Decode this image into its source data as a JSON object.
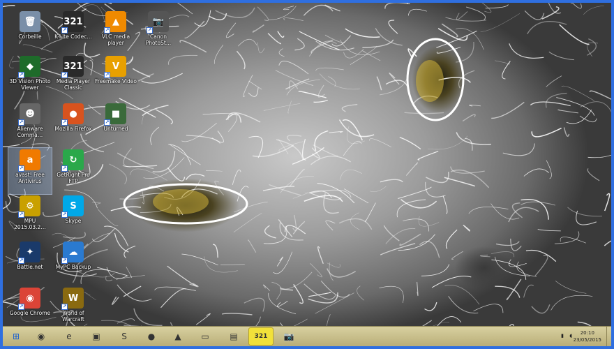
{
  "desktop": {
    "icons": [
      {
        "label": "Corbeille",
        "glyph": "🗑",
        "color": "#7a8fa8",
        "shortcut": false
      },
      {
        "label": "K-Lite Codec…",
        "glyph": "321",
        "color": "#2a2a2a",
        "shortcut": true
      },
      {
        "label": "VLC media player",
        "glyph": "▲",
        "color": "#f08a00",
        "shortcut": true
      },
      {
        "label": "Canon PhotoSt…",
        "glyph": "📷",
        "color": "#555",
        "shortcut": true
      },
      {
        "label": "3D Vision Photo Viewer",
        "glyph": "◆",
        "color": "#1e6b2a",
        "shortcut": true
      },
      {
        "label": "Media Player Classic",
        "glyph": "321",
        "color": "#2a2a2a",
        "shortcut": true
      },
      {
        "label": "Freemake Video",
        "glyph": "V",
        "color": "#e8a000",
        "shortcut": true
      },
      {
        "label": "Alienware Comma…",
        "glyph": "☻",
        "color": "#666",
        "shortcut": true
      },
      {
        "label": "Mozilla Firefox",
        "glyph": "●",
        "color": "#d9531e",
        "shortcut": true
      },
      {
        "label": "Unturned",
        "glyph": "■",
        "color": "#3a6a3a",
        "shortcut": true
      },
      {
        "label": "avast! Free Antivirus",
        "glyph": "a",
        "color": "#f07a00",
        "shortcut": true
      },
      {
        "label": "GetRight Pro FTP",
        "glyph": "↻",
        "color": "#2aa84a",
        "shortcut": true
      },
      {
        "label": "MPU 2015.03.2…",
        "glyph": "⚙",
        "color": "#c9a000",
        "shortcut": true
      },
      {
        "label": "Skype",
        "glyph": "S",
        "color": "#00a8e8",
        "shortcut": true
      },
      {
        "label": "Battle.net",
        "glyph": "✦",
        "color": "#1a3a6a",
        "shortcut": true
      },
      {
        "label": "MyPC Backup",
        "glyph": "☁",
        "color": "#2a7ad0",
        "shortcut": true
      },
      {
        "label": "Google Chrome",
        "glyph": "◉",
        "color": "#db4437",
        "shortcut": true
      },
      {
        "label": "World of Warcraft",
        "glyph": "W",
        "color": "#8a6a10",
        "shortcut": true
      }
    ]
  },
  "taskbar": {
    "items": [
      {
        "name": "start-button",
        "glyph": "⊞",
        "active": false
      },
      {
        "name": "chrome",
        "glyph": "◉",
        "active": false
      },
      {
        "name": "internet-explorer",
        "glyph": "e",
        "active": false
      },
      {
        "name": "store",
        "glyph": "▣",
        "active": false
      },
      {
        "name": "skype",
        "glyph": "S",
        "active": false
      },
      {
        "name": "firefox",
        "glyph": "●",
        "active": false
      },
      {
        "name": "vlc",
        "glyph": "▲",
        "active": false
      },
      {
        "name": "file-explorer",
        "glyph": "▭",
        "active": false
      },
      {
        "name": "app-window",
        "glyph": "▤",
        "active": false
      },
      {
        "name": "media-player-classic",
        "glyph": "321",
        "active": true
      },
      {
        "name": "camera-app",
        "glyph": "📷",
        "active": false
      }
    ],
    "clock": {
      "time": "20:10",
      "date": "23/05/2015"
    }
  }
}
